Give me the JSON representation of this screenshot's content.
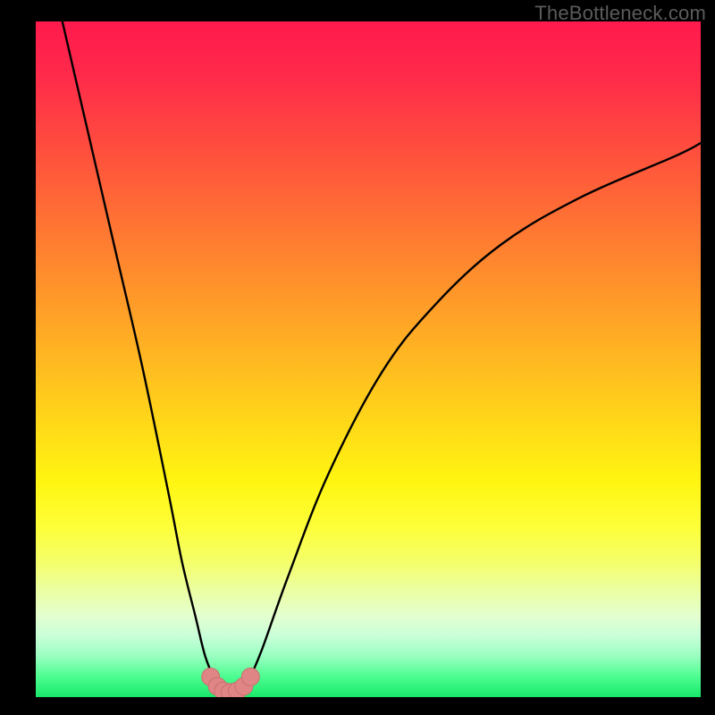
{
  "watermark": "TheBottleneck.com",
  "colors": {
    "frame": "#000000",
    "curve": "#000000",
    "marker_fill": "#e08585",
    "marker_stroke": "#c96f6f"
  },
  "chart_data": {
    "type": "line",
    "title": "",
    "xlabel": "",
    "ylabel": "",
    "xlim": [
      0,
      100
    ],
    "ylim": [
      0,
      100
    ],
    "grid": false,
    "legend": false,
    "notes": "No numeric axes or tick labels are visible; values are estimated from pixel positions on a 0–100 normalized scale. y is inverted relative to screen (0 at bottom).",
    "series": [
      {
        "name": "bottleneck-curve",
        "x": [
          4,
          8,
          12,
          16,
          20,
          22,
          24,
          25.5,
          27,
          28,
          29,
          30,
          31,
          32,
          34,
          38,
          44,
          52,
          60,
          70,
          82,
          96,
          100
        ],
        "y": [
          100,
          83,
          66,
          49,
          30,
          20,
          12,
          6,
          2.5,
          1.2,
          0.7,
          0.7,
          1.2,
          2.5,
          7,
          18,
          33,
          48,
          58,
          67,
          74,
          80,
          82
        ]
      }
    ],
    "markers": {
      "name": "valley-markers",
      "x": [
        26.3,
        27.3,
        28.2,
        29.2,
        30.3,
        31.3,
        32.3
      ],
      "y": [
        3.0,
        1.6,
        0.9,
        0.7,
        0.9,
        1.6,
        3.0
      ],
      "size_pct": 1.6
    }
  }
}
